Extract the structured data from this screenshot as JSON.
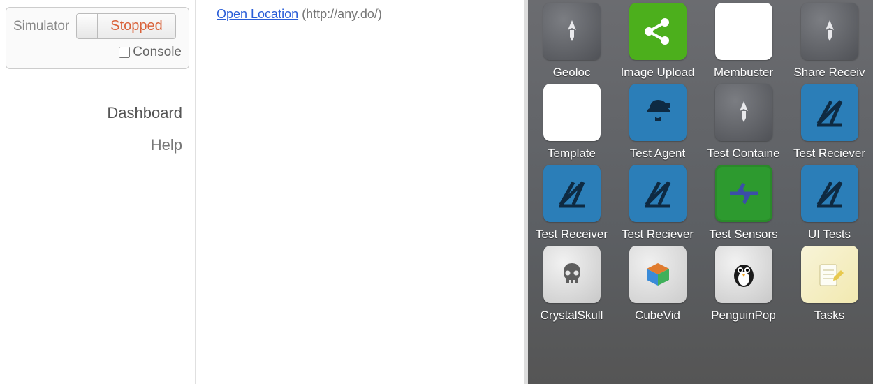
{
  "sidebar": {
    "simulator_label": "Simulator",
    "status_button": "Stopped",
    "console_label": "Console",
    "nav": {
      "dashboard": "Dashboard",
      "help": "Help"
    }
  },
  "location": {
    "link_text": "Open Location",
    "url_text": "(http://any.do/)"
  },
  "apps": {
    "row1": [
      {
        "name": "geoloc",
        "label": "Geoloc",
        "icon": "rocket-grey"
      },
      {
        "name": "image-upload",
        "label": "Image Upload",
        "icon": "share-green"
      },
      {
        "name": "membuster",
        "label": "Membuster",
        "icon": "white-blank"
      },
      {
        "name": "share-receive",
        "label": "Share Receiv",
        "icon": "rocket-grey"
      }
    ],
    "row2": [
      {
        "name": "template",
        "label": "Template",
        "icon": "white-blank"
      },
      {
        "name": "test-agent",
        "label": "Test Agent",
        "icon": "sherlock-blue"
      },
      {
        "name": "test-container",
        "label": "Test Containe",
        "icon": "rocket-grey"
      },
      {
        "name": "test-receiver1",
        "label": "Test Reciever",
        "icon": "compass-blue"
      }
    ],
    "row3": [
      {
        "name": "test-receiver2",
        "label": "Test Receiver",
        "icon": "compass-blue"
      },
      {
        "name": "test-receiver3",
        "label": "Test Reciever",
        "icon": "compass-blue"
      },
      {
        "name": "test-sensors",
        "label": "Test Sensors",
        "icon": "sensors-green"
      },
      {
        "name": "ui-tests",
        "label": "UI Tests",
        "icon": "compass-blue"
      }
    ],
    "row4": [
      {
        "name": "crystalskull",
        "label": "CrystalSkull",
        "icon": "skull-circ"
      },
      {
        "name": "cubevid",
        "label": "CubeVid",
        "icon": "cube-circ"
      },
      {
        "name": "penguinpop",
        "label": "PenguinPop",
        "icon": "penguin-circ"
      },
      {
        "name": "tasks",
        "label": "Tasks",
        "icon": "notes-circ"
      }
    ]
  }
}
